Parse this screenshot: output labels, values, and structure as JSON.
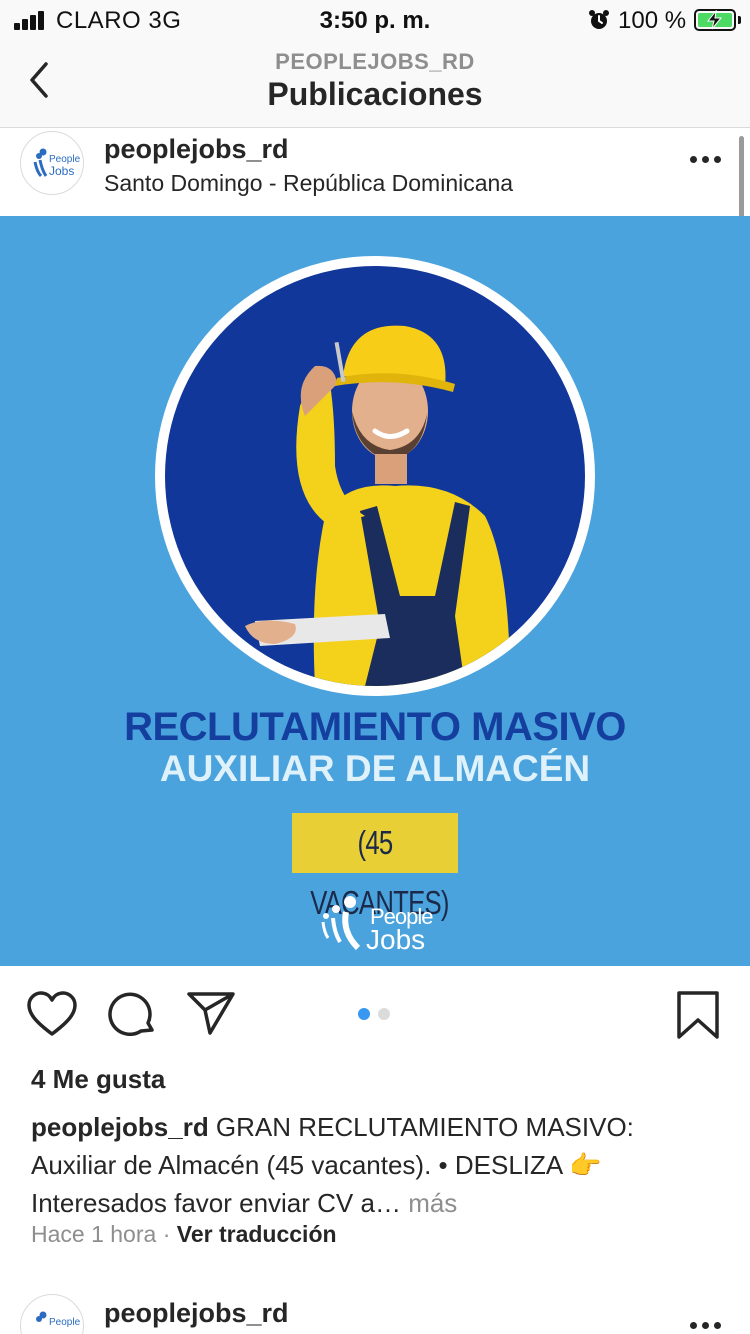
{
  "status_bar": {
    "carrier": "CLARO  3G",
    "time": "3:50 p. m.",
    "battery_percent": "100 %",
    "icons": [
      "signal-icon",
      "alarm-icon",
      "battery-charging-icon"
    ],
    "battery_color": "#4cd964"
  },
  "nav": {
    "subtitle": "PEOPLEJOBS_RD",
    "title": "Publicaciones",
    "back_icon": "chevron-left-icon"
  },
  "post": {
    "username": "peoplejobs_rd",
    "location": "Santo Domingo - República Dominicana",
    "more_icon": "more-horizontal-icon",
    "image": {
      "headline_1": "RECLUTAMIENTO MASIVO",
      "headline_2": "AUXILIAR DE ALMACÉN",
      "vacantes": "(45 VACANTES)",
      "logo_people": "People",
      "logo_jobs": "Jobs",
      "background_color": "#4aa3dd",
      "circle_color": "#12379b"
    },
    "carousel": {
      "total": 2,
      "active": 1
    },
    "actions": [
      "heart-icon",
      "comment-icon",
      "share-icon",
      "bookmark-icon"
    ],
    "likes": "4 Me gusta",
    "caption_user": "peoplejobs_rd",
    "caption_text": " GRAN RECLUTAMIENTO MASIVO: Auxiliar de Almacén (45 vacantes). • DESLIZA 👉 Interesados favor enviar CV a…",
    "caption_more": " más",
    "time_ago": "Hace 1 hora",
    "separator": " · ",
    "translate": "Ver traducción"
  },
  "next_post": {
    "username": "peoplejobs_rd"
  },
  "colors": {
    "accent": "#3897f0",
    "text": "#262626",
    "muted": "#8e8e8e"
  }
}
